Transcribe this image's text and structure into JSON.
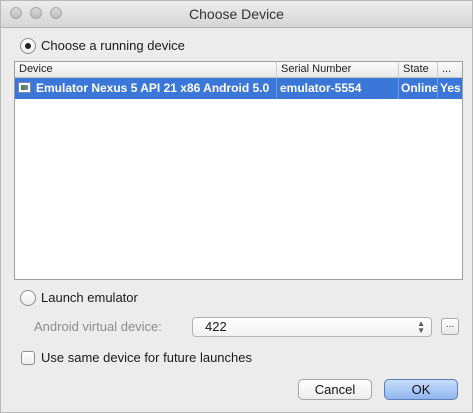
{
  "window": {
    "title": "Choose Device"
  },
  "running": {
    "label": "Choose a running device",
    "selected": true
  },
  "table": {
    "columns": [
      "Device",
      "Serial Number",
      "State",
      "..."
    ],
    "rows": [
      {
        "device": "Emulator Nexus 5 API 21 x86 Android 5.0",
        "serial": "emulator-5554",
        "state": "Online",
        "compatible": "Yes"
      }
    ]
  },
  "launch": {
    "label": "Launch emulator",
    "selected": false
  },
  "avd": {
    "label": "Android virtual device:",
    "value": "422",
    "browse_label": "..."
  },
  "same_device": {
    "label": "Use same device for future launches",
    "checked": false
  },
  "buttons": {
    "cancel": "Cancel",
    "ok": "OK"
  },
  "colors": {
    "selection": "#3b77d8",
    "default_button": "#8fb6ee"
  }
}
